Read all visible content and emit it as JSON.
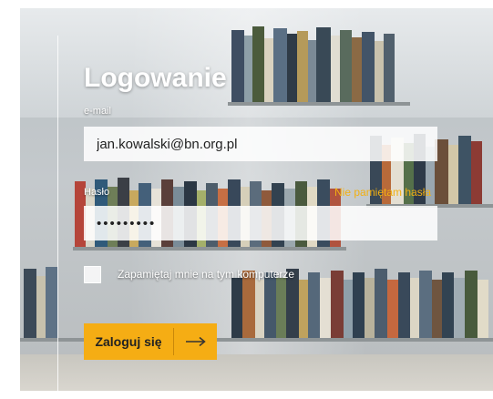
{
  "form": {
    "title": "Logowanie",
    "email_label": "e-mail",
    "email_value": "jan.kowalski@bn.org.pl",
    "password_label": "Hasło",
    "password_value": "•••••••••",
    "forgot_password": "Nie pamiętam hasła",
    "remember_label": "Zapamiętaj mnie na tym komputerze",
    "remember_checked": false,
    "submit_label": "Zaloguj się",
    "submit_icon": "arrow-right-icon"
  },
  "colors": {
    "accent": "#f5ad14",
    "link": "#f2b012",
    "text_on_image": "#ffffff"
  }
}
